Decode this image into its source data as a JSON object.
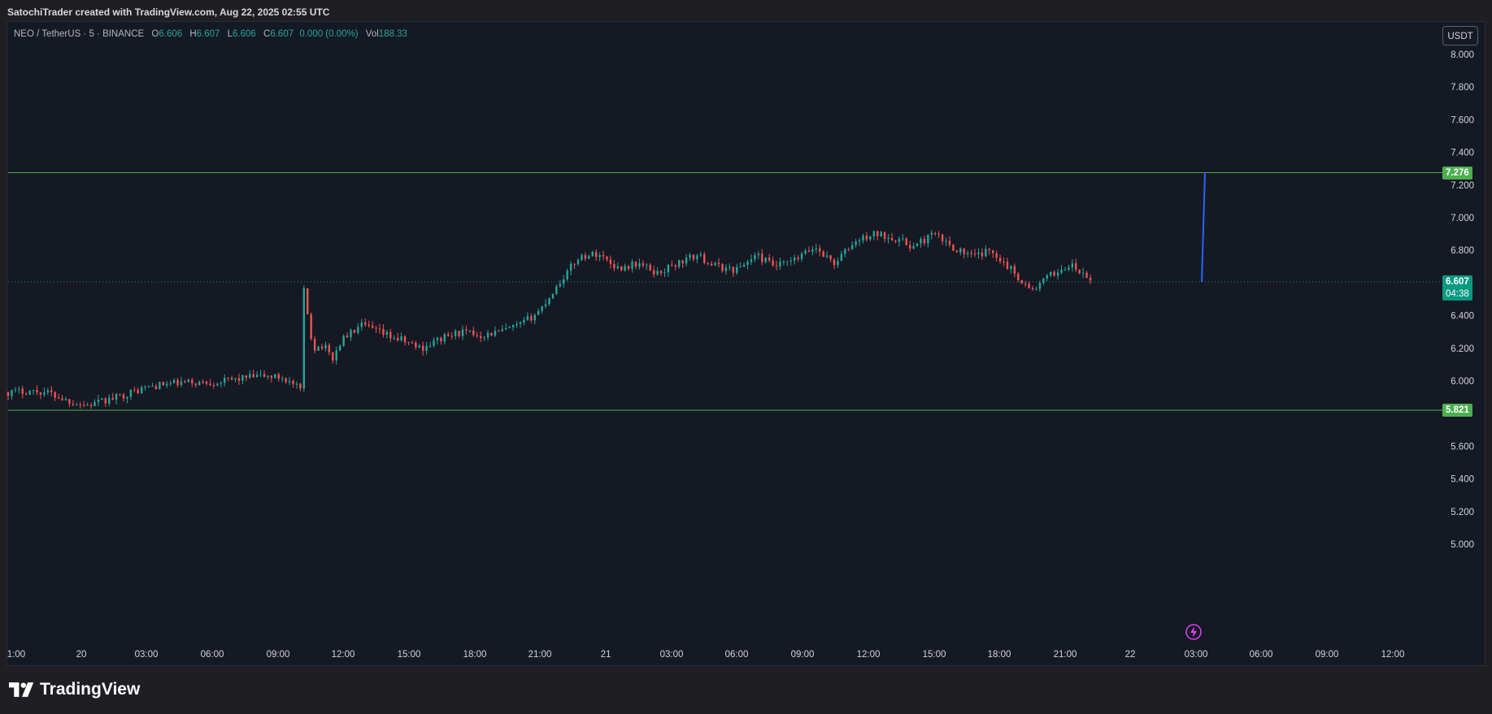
{
  "caption": "SatochiTrader created with TradingView.com, Aug 22, 2025 02:55 UTC",
  "legend": {
    "symbol": "NEO / TetherUS · 5 · BINANCE",
    "o_label": "O",
    "o": "6.606",
    "h_label": "H",
    "h": "6.607",
    "l_label": "L",
    "l": "6.606",
    "c_label": "C",
    "c": "6.607",
    "change": "0.000 (0.00%)",
    "vol_label": "Vol",
    "vol": "188.33"
  },
  "currency_button": "USDT",
  "brand": "TradingView",
  "colors": {
    "background": "#151924",
    "up": "#26a69a",
    "down": "#ef5350",
    "level_line": "#4caf50",
    "current_price": "#089981",
    "projection": "#2962ff",
    "alert_icon": "#e040fb"
  },
  "chart_data": {
    "type": "candlestick",
    "symbol": "NEO / TetherUS",
    "interval": "5",
    "exchange": "BINANCE",
    "y_ticks": [
      "8.000",
      "7.800",
      "7.600",
      "7.400",
      "7.200",
      "7.000",
      "6.800",
      "6.400",
      "6.200",
      "6.000",
      "5.600",
      "5.400",
      "5.200",
      "5.000"
    ],
    "x_ticks": [
      "1:00",
      "20",
      "03:00",
      "06:00",
      "09:00",
      "12:00",
      "15:00",
      "18:00",
      "21:00",
      "21",
      "03:00",
      "06:00",
      "09:00",
      "12:00",
      "15:00",
      "18:00",
      "21:00",
      "22",
      "03:00",
      "06:00",
      "09:00",
      "12:00"
    ],
    "ylim": [
      4.99,
      8.19
    ],
    "price_path": [
      {
        "t": 0,
        "p": 5.93
      },
      {
        "t": 1,
        "p": 5.94
      },
      {
        "t": 2,
        "p": 5.93
      },
      {
        "t": 3,
        "p": 5.88
      },
      {
        "t": 4,
        "p": 5.85
      },
      {
        "t": 5,
        "p": 5.88
      },
      {
        "t": 6,
        "p": 5.92
      },
      {
        "t": 7,
        "p": 5.96
      },
      {
        "t": 8,
        "p": 5.98
      },
      {
        "t": 9,
        "p": 5.99
      },
      {
        "t": 10,
        "p": 5.99
      },
      {
        "t": 11,
        "p": 6.0
      },
      {
        "t": 12,
        "p": 6.02
      },
      {
        "t": 13,
        "p": 6.03
      },
      {
        "t": 14,
        "p": 6.02
      },
      {
        "t": 14.9,
        "p": 5.94
      },
      {
        "t": 15,
        "p": 6.57
      },
      {
        "t": 15.5,
        "p": 6.2
      },
      {
        "t": 16,
        "p": 6.22
      },
      {
        "t": 16.5,
        "p": 6.14
      },
      {
        "t": 17,
        "p": 6.26
      },
      {
        "t": 18,
        "p": 6.34
      },
      {
        "t": 19,
        "p": 6.29
      },
      {
        "t": 20,
        "p": 6.25
      },
      {
        "t": 21,
        "p": 6.2
      },
      {
        "t": 22,
        "p": 6.26
      },
      {
        "t": 23,
        "p": 6.3
      },
      {
        "t": 24,
        "p": 6.28
      },
      {
        "t": 25,
        "p": 6.3
      },
      {
        "t": 26,
        "p": 6.34
      },
      {
        "t": 27,
        "p": 6.43
      },
      {
        "t": 28,
        "p": 6.6
      },
      {
        "t": 29,
        "p": 6.76
      },
      {
        "t": 30,
        "p": 6.78
      },
      {
        "t": 31,
        "p": 6.69
      },
      {
        "t": 32,
        "p": 6.72
      },
      {
        "t": 33,
        "p": 6.66
      },
      {
        "t": 34,
        "p": 6.72
      },
      {
        "t": 35,
        "p": 6.77
      },
      {
        "t": 36,
        "p": 6.7
      },
      {
        "t": 37,
        "p": 6.68
      },
      {
        "t": 38,
        "p": 6.77
      },
      {
        "t": 39,
        "p": 6.7
      },
      {
        "t": 40,
        "p": 6.74
      },
      {
        "t": 41,
        "p": 6.82
      },
      {
        "t": 42,
        "p": 6.72
      },
      {
        "t": 43,
        "p": 6.85
      },
      {
        "t": 44,
        "p": 6.9
      },
      {
        "t": 45,
        "p": 6.88
      },
      {
        "t": 46,
        "p": 6.82
      },
      {
        "t": 47,
        "p": 6.9
      },
      {
        "t": 48,
        "p": 6.82
      },
      {
        "t": 49,
        "p": 6.76
      },
      {
        "t": 50,
        "p": 6.8
      },
      {
        "t": 51,
        "p": 6.68
      },
      {
        "t": 52,
        "p": 6.55
      },
      {
        "t": 53,
        "p": 6.65
      },
      {
        "t": 54,
        "p": 6.71
      },
      {
        "t": 55,
        "p": 6.61
      }
    ],
    "current_price": "6.607",
    "countdown": "04:38",
    "horizontal_levels": [
      {
        "value": 7.276,
        "label": "7.276"
      },
      {
        "value": 5.821,
        "label": "5.821"
      }
    ],
    "projection": {
      "from": 6.607,
      "to": 7.276
    },
    "grid": false,
    "price_scale_position": "right"
  }
}
